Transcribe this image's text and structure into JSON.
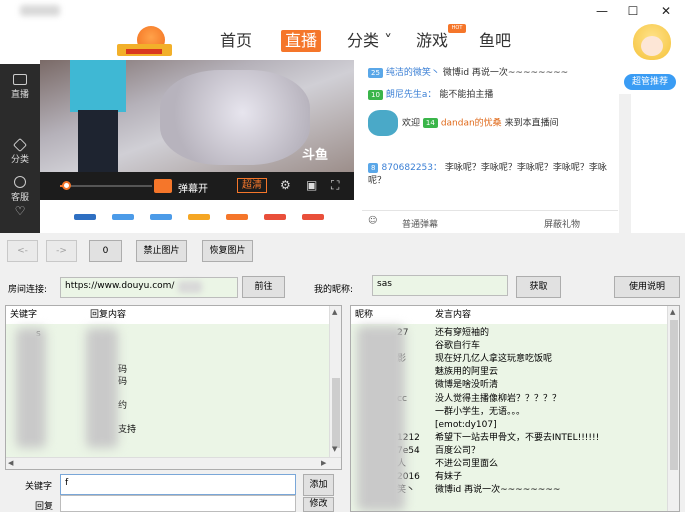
{
  "window": {
    "minimize": "—",
    "maximize": "☐",
    "close": "✕"
  },
  "site": {
    "nav": [
      {
        "label": "首页",
        "active": false
      },
      {
        "label": "直播",
        "active": true
      },
      {
        "label": "分类 ˅",
        "active": false
      },
      {
        "label": "游戏",
        "active": false,
        "badge": "HOT"
      },
      {
        "label": "鱼吧",
        "active": false
      }
    ],
    "mascot_badge": "超管推荐",
    "sidebar": [
      "直播",
      "分类",
      "客服"
    ],
    "video_watermark": "斗鱼",
    "player": {
      "danmu_toggle": "弹幕开",
      "quality": "超清",
      "progress": 0.05
    },
    "chat": [
      {
        "level": "25",
        "level_color": "#5aa7e8",
        "user": "纯洁的微笑丶",
        "text": "微博id 再说一次~~~~~~~~"
      },
      {
        "level": "10",
        "level_color": "#3ab54a",
        "user": "朗尼先生a：",
        "text": "能不能拍主播"
      },
      {
        "prefix": "欢迎",
        "level": "14",
        "level_color": "#3ab54a",
        "user": "dandan的忧桑",
        "text": "来到本直播间"
      },
      {
        "level": "8",
        "level_color": "#5aa7e8",
        "user": "870682253：",
        "text": "李咏呢？李咏呢？李咏呢？李咏呢？李咏呢？"
      }
    ],
    "chat_footer": {
      "left": "普通弹幕",
      "right": "屏蔽礼物"
    }
  },
  "controls": {
    "back": "<-",
    "forward": "->",
    "zero": "0",
    "block_images": "禁止图片",
    "restore_images": "恢复图片",
    "room_label": "房间连接:",
    "room_url": "https://www.douyu.com/",
    "go": "前往",
    "nick_label": "我的昵称:",
    "nick_value": "sas",
    "fetch": "获取",
    "help": "使用说明"
  },
  "left_grid": {
    "headers": [
      "关键字",
      "回复内容"
    ],
    "rows": [
      {
        "keyword": "s",
        "reply": ""
      },
      {
        "keyword": "",
        "reply": ""
      },
      {
        "keyword": "",
        "reply": ""
      },
      {
        "keyword": "",
        "reply": "码"
      },
      {
        "keyword": "",
        "reply": "码"
      },
      {
        "keyword": "",
        "reply": ""
      },
      {
        "keyword": "",
        "reply": "约"
      },
      {
        "keyword": "",
        "reply": ""
      },
      {
        "keyword": "",
        "reply": "支持"
      },
      {
        "keyword": "",
        "reply": ""
      }
    ]
  },
  "right_grid": {
    "headers": [
      "昵称",
      "发言内容"
    ],
    "rows": [
      {
        "nick": "27",
        "text": "还有穿短袖的"
      },
      {
        "nick": "",
        "text": "谷歌自行车"
      },
      {
        "nick": "影",
        "text": "现在好几亿人拿这玩意吃饭呢"
      },
      {
        "nick": "",
        "text": "魅族用的阿里云"
      },
      {
        "nick": "",
        "text": "微博是啥没听清"
      },
      {
        "nick": "cc",
        "text": "没人觉得主播像柳岩？？？？？"
      },
      {
        "nick": "",
        "text": "一群小学生，无语。。。"
      },
      {
        "nick": "",
        "text": "[emot:dy107]"
      },
      {
        "nick": "1212",
        "text": "希望下一站去甲骨文，不要去INTEL!!!!!!"
      },
      {
        "nick": "7e54",
        "text": "百度公司？"
      },
      {
        "nick": "人",
        "text": "不进公司里面么"
      },
      {
        "nick": "2016",
        "text": "有妹子"
      },
      {
        "nick": "笑丶",
        "text": "微博id 再说一次~~~~~~~~"
      }
    ]
  },
  "editor": {
    "keyword_label": "关键字",
    "keyword_value": "f",
    "reply_label": "回复",
    "reply_value": "",
    "add": "添加",
    "modify": "修改"
  },
  "colors": {
    "accent": "#f5762a",
    "grid_bg": "#ebf5e6",
    "link": "#3a7fd5"
  }
}
